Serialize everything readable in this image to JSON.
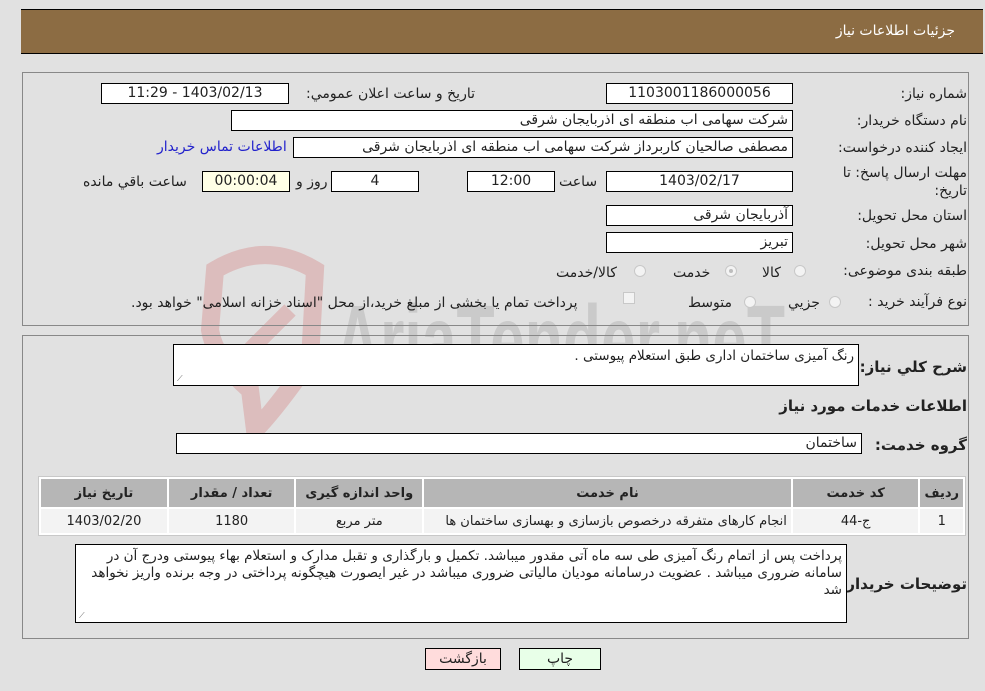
{
  "header": {
    "title": "جزئیات اطلاعات نیاز"
  },
  "form": {
    "need_number": {
      "label": "شماره نیاز:",
      "value": "1103001186000056"
    },
    "announce_datetime": {
      "label": "تاریخ و ساعت اعلان عمومي:",
      "value": "1403/02/13 - 11:29"
    },
    "buyer_org": {
      "label": "نام دستگاه خريدار:",
      "value": "شرکت سهامی اب منطقه ای اذربایجان شرقی"
    },
    "requester": {
      "label": "ايجاد کننده درخواست:",
      "value": "مصطفی صالحیان کاربرداز شرکت سهامی اب منطقه ای اذربایجان شرقی",
      "contact_link": "اطلاعات تماس خریدار"
    },
    "deadline": {
      "label_line1": "مهلت ارسال پاسخ: تا",
      "label_line2": "تاریخ:",
      "date": "1403/02/17",
      "time_label": "ساعت",
      "time": "12:00",
      "days": "4",
      "days_label": "روز و",
      "remaining": "00:00:04",
      "remaining_label": "ساعت باقي مانده"
    },
    "province": {
      "label": "استان محل تحویل:",
      "value": "آذربایجان شرقی"
    },
    "city": {
      "label": "شهر محل تحویل:",
      "value": "تبریز"
    },
    "category": {
      "label": "طبقه بندی موضوعی:",
      "options": [
        "کالا",
        "خدمت",
        "کالا/خدمت"
      ],
      "selected": "خدمت"
    },
    "purchase_type": {
      "label": "نوع فرآیند خرید :",
      "options": [
        "جزيي",
        "متوسط"
      ],
      "checkbox_label": "پرداخت تمام یا بخشی از مبلغ خرید،از محل \"اسناد خزانه اسلامی\" خواهد بود."
    }
  },
  "details": {
    "description": {
      "label": "شرح کلي نياز:",
      "value": "رنگ آمیزی ساختمان اداری طبق استعلام پیوستی ."
    },
    "services_heading": "اطلاعات خدمات مورد نياز",
    "service_group": {
      "label": "گروه خدمت:",
      "value": "ساختمان"
    },
    "table": {
      "headers": [
        "رديف",
        "کد خدمت",
        "نام خدمت",
        "واحد اندازه گيری",
        "تعداد / مقدار",
        "تاريخ نياز"
      ],
      "rows": [
        [
          "1",
          "ج-44",
          "انجام کارهای متفرقه درخصوص بازسازی و بهسازی ساختمان ها",
          "متر مربع",
          "1180",
          "1403/02/20"
        ]
      ]
    },
    "buyer_notes": {
      "label": "توضيحات خريدار:",
      "value": "پرداخت پس از اتمام رنگ آمیزی طی سه ماه آتی مقدور میباشد. تکمیل و بارگذاری و تقبل مدارک و استعلام بهاء پیوستی ودرج آن در سامانه ضروری میباشد . عضویت درسامانه مودیان مالیاتی ضروری میباشد در غیر ایصورت هیچگونه پرداختی در وجه برنده واریز نخواهد شد"
    }
  },
  "buttons": {
    "print": "چاپ",
    "back": "بازگشت"
  },
  "watermark": {
    "text": "AriaTender.neT"
  },
  "colors": {
    "header_bg": "#8c6c43",
    "page_bg": "#e1e1e1",
    "link": "#2222cc",
    "back_btn": "#ffdcdc",
    "print_btn": "#e8ffe8"
  }
}
